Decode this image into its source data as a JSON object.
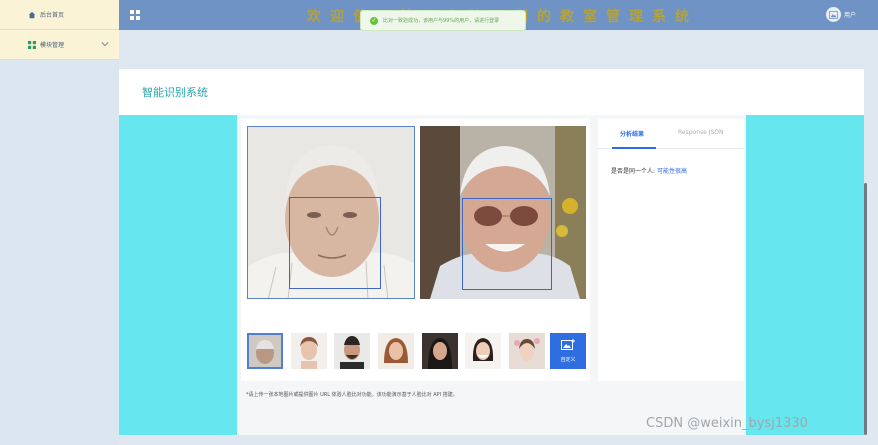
{
  "sidebar": {
    "items": [
      {
        "label": "后台首页",
        "icon": "home-icon"
      },
      {
        "label": "模块管理",
        "icon": "grid-icon",
        "expandable": true
      }
    ]
  },
  "header": {
    "title": "欢迎使用基于人脸识别的教室管理系统",
    "user_label": "用户",
    "bg_color": "#6e93c4"
  },
  "toast": {
    "message": "比对一致验成功，该用户与99%的用户，请进行登录"
  },
  "page": {
    "title": "智能识别系统"
  },
  "result_panel": {
    "tabs": [
      {
        "label": "分析结果",
        "active": true
      },
      {
        "label": "Response JSON",
        "active": false
      }
    ],
    "result_label": "是否是同一个人:",
    "result_value": "可能性很高"
  },
  "thumbnails": {
    "count": 7,
    "selected_index": 0,
    "custom_label": "自定义"
  },
  "note": "*请上传一张本地图片或提供图片 URL 体验人脸比对功能。该功能演示基于人脸比对 API 搭建。",
  "watermark": "CSDN @weixin_bysj1330",
  "colors": {
    "accent": "#2f6ee0",
    "cyan": "#66e6ef",
    "title": "#2aa6ad"
  }
}
